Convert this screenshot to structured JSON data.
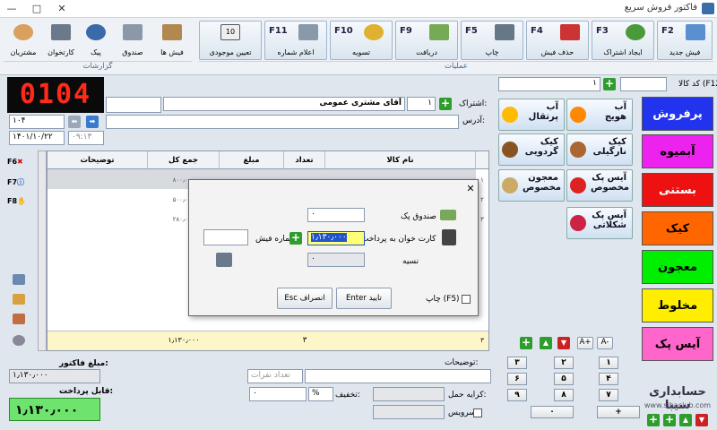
{
  "window": {
    "title": "فاکتور فروش سریع",
    "minimize": "—",
    "maximize": "□",
    "close": "✕"
  },
  "ribbon": {
    "buttons": [
      {
        "key": "F2",
        "label": "فیش جدید"
      },
      {
        "key": "F3",
        "label": "ایجاد اشتراک"
      },
      {
        "key": "F4",
        "label": "حذف فیش"
      },
      {
        "key": "F5",
        "label": "چاپ"
      },
      {
        "key": "F9",
        "label": "دریافت"
      },
      {
        "key": "F10",
        "label": "تسویه"
      },
      {
        "key": "F11",
        "label": "اعلام شماره"
      },
      {
        "key": "",
        "label": "تعیین موجودی"
      }
    ],
    "small_buttons": [
      "فیش ها",
      "صندوق",
      "پیک",
      "کارتخوان",
      "مشتریان"
    ],
    "groups": {
      "operations": "عملیات",
      "reports": "گزارشات"
    }
  },
  "display": {
    "number": "0104"
  },
  "header": {
    "code_label": "کد کالا (F12):",
    "code_value": "",
    "qty_value": "۱",
    "subscription_label": "اشتراک:",
    "subscription_number": "۱",
    "customer_name": "آقای مشتری عمومی",
    "address_label": "آدرس:",
    "invoice_number": "۱۰۴",
    "date": "۱۴۰۱/۱۰/۲۲",
    "time": "۰۹:۱۳"
  },
  "grid": {
    "columns": [
      "نام کالا",
      "تعداد",
      "مبلغ",
      "جمع کل",
      "توضیحات"
    ],
    "rows": [
      {
        "total": "۸۰۰٫۰۰۰",
        "num": "۱"
      },
      {
        "total": "۵۰۰٫۰۰۰",
        "num": "۲"
      },
      {
        "total": "۲۸۰٫۰۰۰",
        "num": "۳"
      }
    ],
    "footer": {
      "qty": "۳",
      "total": "۱٫۱۳۰٫۰۰۰",
      "num": "۳"
    },
    "side_keys": [
      "F6",
      "F7",
      "F8"
    ]
  },
  "categories": [
    {
      "label": "پرفروش",
      "bg": "#2233ee",
      "fg": "#ffffff"
    },
    {
      "label": "آبمیوه",
      "bg": "#ee22ee",
      "fg": "#000000"
    },
    {
      "label": "بستنی",
      "bg": "#ee1111",
      "fg": "#ffffff"
    },
    {
      "label": "کیک",
      "bg": "#ff6600",
      "fg": "#000000"
    },
    {
      "label": "معجون",
      "bg": "#00ee00",
      "fg": "#000000"
    },
    {
      "label": "مخلوط",
      "bg": "#ffee00",
      "fg": "#000000"
    },
    {
      "label": "آیس پک",
      "bg": "#ff66cc",
      "fg": "#000000"
    }
  ],
  "products": [
    {
      "label": "آب هویج",
      "color": "#ff8800"
    },
    {
      "label": "آب پرتقال",
      "color": "#ffbb00"
    },
    {
      "label": "کیک نارگیلی",
      "color": "#aa6633"
    },
    {
      "label": "کیک گردویی",
      "color": "#885522"
    },
    {
      "label": "آیس پک مخصوص",
      "color": "#dd2222"
    },
    {
      "label": "معجون مخصوص",
      "color": "#ccaa66"
    },
    {
      "label": "آیس پک شکلاتی",
      "color": "#cc2244"
    }
  ],
  "keypad": [
    "۱",
    "۲",
    "۳",
    "۴",
    "۵",
    "۶",
    "۷",
    "۸",
    "۹",
    "۰",
    "+"
  ],
  "bottom": {
    "desc_label": "توضیحات:",
    "people_placeholder": "تعداد نفرات",
    "delivery_label": "کرایه حمل:",
    "discount_label": "تخفیف:",
    "discount_unit": "%",
    "discount_value": "۰",
    "service_label": "سرویس:",
    "invoice_amount_label": "مبلغ فاکتور:",
    "invoice_amount": "۱٫۱۳۰٫۰۰۰",
    "payable_label": "قابل پرداخت:",
    "payable": "۱٫۱۳۰٫۰۰۰",
    "brand": "حسابداری سیبا",
    "site": "www.sibaclub.com"
  },
  "dialog": {
    "cash_label": "صندوق پک",
    "cash_value": "۰",
    "card_label": "کارت خوان به پرداخت",
    "card_value": "۱٫۱۳۰٫۰۰۰",
    "receipt_label": "شماره فیش:",
    "receipt_value": "",
    "credit_label": "نسیه",
    "credit_value": "۰",
    "confirm": "Enter تایید",
    "cancel": "Esc انصراف",
    "print_label": "چاپ (F5)"
  }
}
